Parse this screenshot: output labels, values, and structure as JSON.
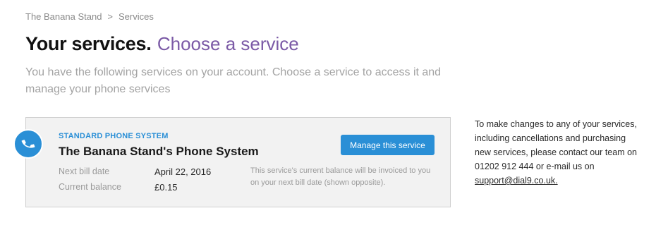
{
  "breadcrumb": {
    "home": "The Banana Stand",
    "separator": ">",
    "current": "Services"
  },
  "page": {
    "title": "Your services.",
    "subtitle": "Choose a service",
    "intro": "You have the following services on your account. Choose a service to access it and manage your phone services"
  },
  "service": {
    "icon": "phone-icon",
    "type": "STANDARD PHONE SYSTEM",
    "name": "The Banana Stand's Phone System",
    "manage_label": "Manage this service",
    "next_bill_label": "Next bill date",
    "next_bill_value": "April 22, 2016",
    "balance_label": "Current balance",
    "balance_value": "£0.15",
    "balance_note": "This service's current balance will be invoiced to you on your next bill date (shown opposite)."
  },
  "sidebar": {
    "note": "To make changes to any of your services, including cancellations and purchasing new services, please contact our team on 01202 912 444 or e-mail us on ",
    "email": "support@dial9.co.uk."
  },
  "colors": {
    "accent": "#2a8fd6",
    "subtitle": "#7b5aa6",
    "card_bg": "#f2f2f2"
  }
}
